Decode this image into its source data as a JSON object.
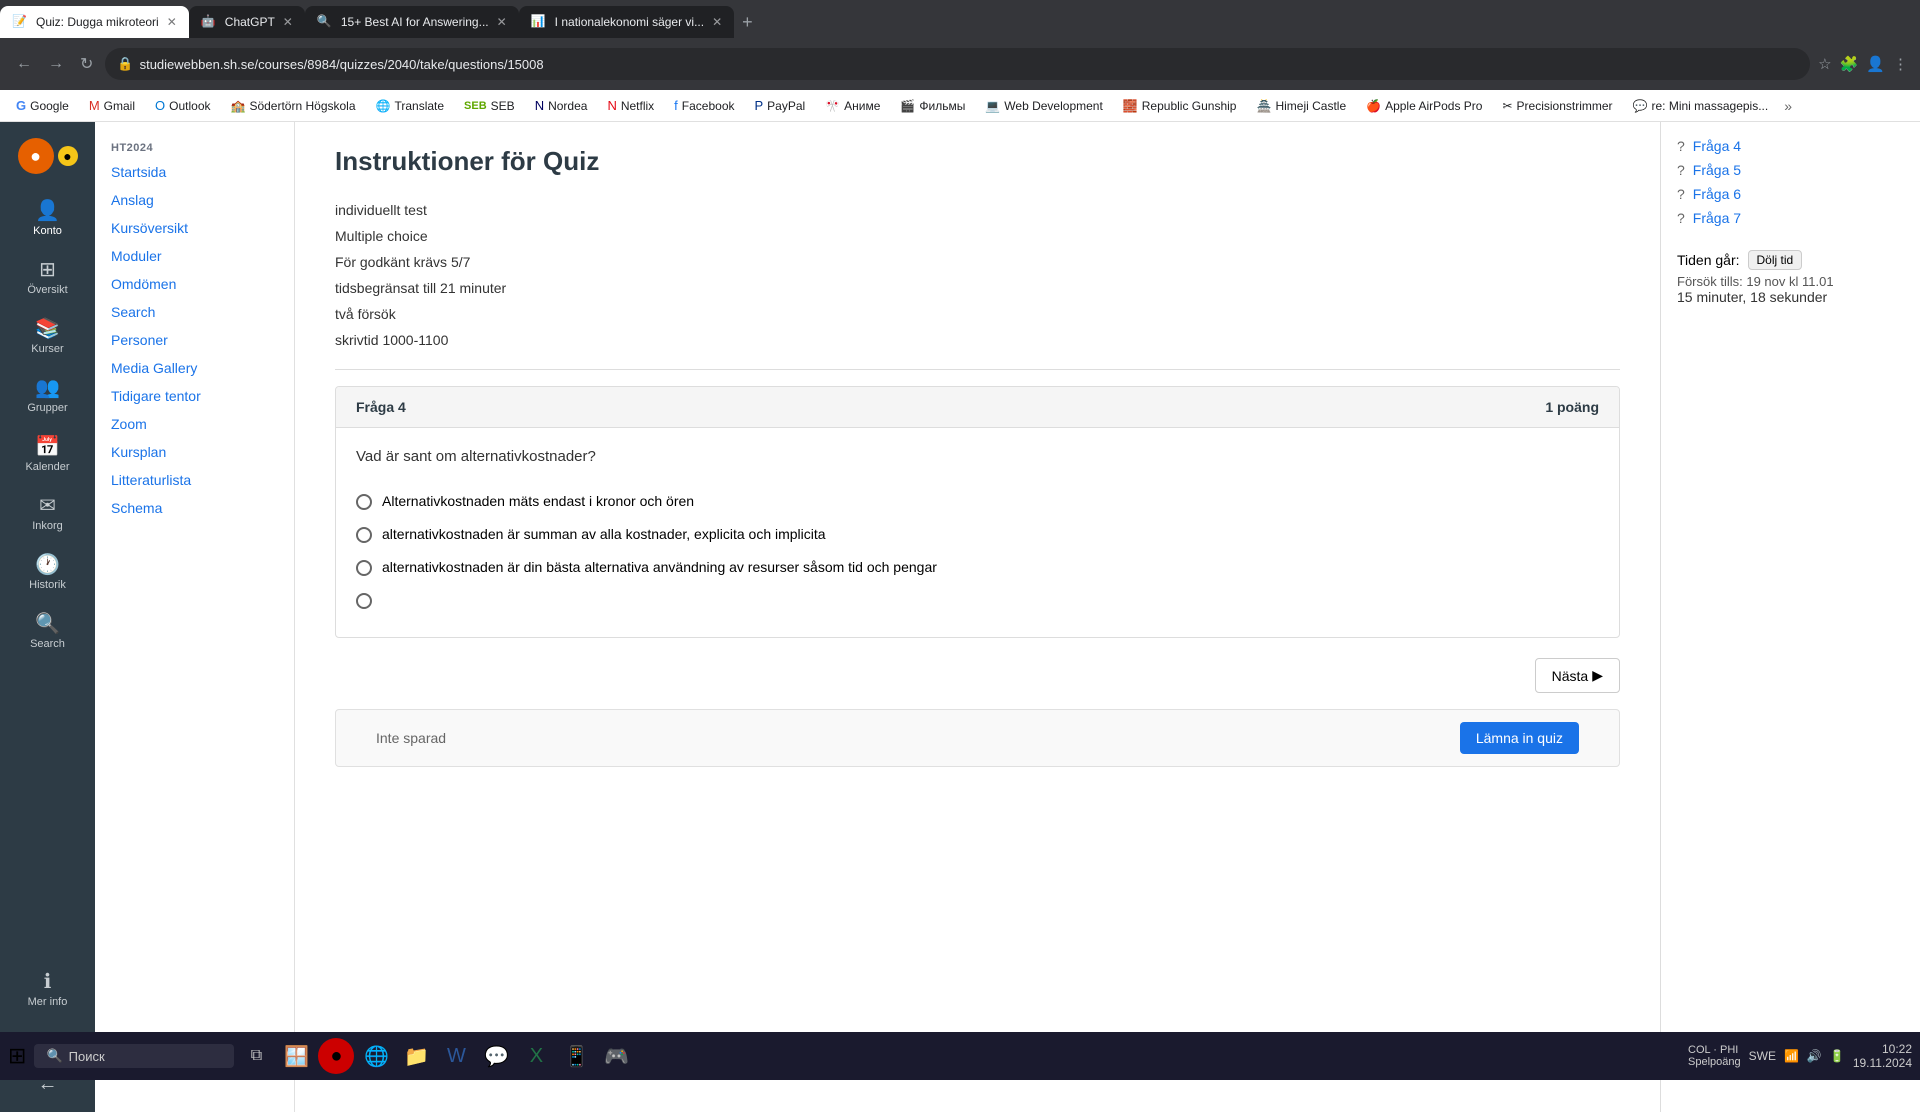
{
  "browser": {
    "tabs": [
      {
        "id": "tab1",
        "title": "Quiz: Dugga mikroteori",
        "active": true,
        "favicon": "📝"
      },
      {
        "id": "tab2",
        "title": "ChatGPT",
        "active": false,
        "favicon": "🤖"
      },
      {
        "id": "tab3",
        "title": "15+ Best AI for Answering...",
        "active": false,
        "favicon": "🔍"
      },
      {
        "id": "tab4",
        "title": "I nationalekonomi säger vi...",
        "active": false,
        "favicon": "📊"
      }
    ],
    "url": "studiewebben.sh.se/courses/8984/quizzes/2040/take/questions/15008",
    "bookmarks": [
      {
        "label": "Google",
        "icon": "G"
      },
      {
        "label": "Gmail",
        "icon": "M"
      },
      {
        "label": "Outlook",
        "icon": "O"
      },
      {
        "label": "Södertörn Högskola",
        "icon": "S"
      },
      {
        "label": "Translate",
        "icon": "T"
      },
      {
        "label": "SEB",
        "icon": "SEB"
      },
      {
        "label": "Nordea",
        "icon": "N"
      },
      {
        "label": "Netflix",
        "icon": "N"
      },
      {
        "label": "Facebook",
        "icon": "f"
      },
      {
        "label": "PayPal",
        "icon": "P"
      },
      {
        "label": "Аниме",
        "icon": "A"
      },
      {
        "label": "Фильмы",
        "icon": "F"
      },
      {
        "label": "Web Development",
        "icon": "W"
      },
      {
        "label": "Republic Gunship",
        "icon": "R"
      },
      {
        "label": "Himeji Castle",
        "icon": "H"
      },
      {
        "label": "Apple AirPods Pro",
        "icon": "A"
      },
      {
        "label": "Precisionstrimmer",
        "icon": "P"
      },
      {
        "label": "re: Mini massagepis...",
        "icon": "m"
      }
    ]
  },
  "lms_sidebar": {
    "items": [
      {
        "id": "account",
        "label": "Konto",
        "icon": "👤"
      },
      {
        "id": "overview",
        "label": "Översikt",
        "icon": "⊞"
      },
      {
        "id": "courses",
        "label": "Kurser",
        "icon": "📚"
      },
      {
        "id": "groups",
        "label": "Grupper",
        "icon": "👥"
      },
      {
        "id": "calendar",
        "label": "Kalender",
        "icon": "📅"
      },
      {
        "id": "inbox",
        "label": "Inkorg",
        "icon": "✉"
      },
      {
        "id": "history",
        "label": "Historik",
        "icon": "🕐"
      },
      {
        "id": "search",
        "label": "Search",
        "icon": "🔍"
      },
      {
        "id": "more",
        "label": "Mer info",
        "icon": "ℹ"
      }
    ]
  },
  "nav_sidebar": {
    "section_label": "HT2024",
    "items": [
      {
        "id": "startsida",
        "label": "Startsida"
      },
      {
        "id": "anslag",
        "label": "Anslag"
      },
      {
        "id": "kursöversikt",
        "label": "Kursöversikt"
      },
      {
        "id": "moduler",
        "label": "Moduler"
      },
      {
        "id": "omdömen",
        "label": "Omdömen"
      },
      {
        "id": "search",
        "label": "Search"
      },
      {
        "id": "personer",
        "label": "Personer"
      },
      {
        "id": "media_gallery",
        "label": "Media Gallery"
      },
      {
        "id": "tidigare_tentor",
        "label": "Tidigare tentor"
      },
      {
        "id": "zoom",
        "label": "Zoom"
      },
      {
        "id": "kursplan",
        "label": "Kursplan"
      },
      {
        "id": "litteraturlista",
        "label": "Litteraturlista"
      },
      {
        "id": "schema",
        "label": "Schema"
      }
    ]
  },
  "page": {
    "title": "Instruktioner för Quiz",
    "info_rows": [
      {
        "id": "type",
        "text": "individuellt test"
      },
      {
        "id": "format",
        "text": "Multiple choice"
      },
      {
        "id": "pass",
        "text": "För godkänt krävs 5/7"
      },
      {
        "id": "time_limit",
        "text": "tidsbegränsat till 21 minuter"
      },
      {
        "id": "attempts",
        "text": "två försök"
      },
      {
        "id": "write_time",
        "text": "skrivtid 1000-1100"
      }
    ]
  },
  "question": {
    "title": "Fråga 4",
    "points": "1 poäng",
    "text": "Vad är sant om alternativkostnader?",
    "options": [
      {
        "id": "a",
        "text": "Alternativkostnaden mäts endast i kronor och ören"
      },
      {
        "id": "b",
        "text": "alternativkostnaden är summan av alla kostnader, explicita och implicita"
      },
      {
        "id": "c",
        "text": "alternativkostnaden är din bästa alternativa användning av resurser såsom tid och pengar"
      },
      {
        "id": "d",
        "text": ""
      }
    ]
  },
  "right_sidebar": {
    "question_nav": [
      {
        "id": "fraga4",
        "label": "Fråga 4"
      },
      {
        "id": "fraga5",
        "label": "Fråga 5"
      },
      {
        "id": "fraga6",
        "label": "Fråga 6"
      },
      {
        "id": "fraga7",
        "label": "Fråga 7"
      }
    ],
    "timer": {
      "label": "Tiden går:",
      "hide_btn": "Dölj tid",
      "attempt_info": "Försök tills: 19 nov kl 11.01",
      "countdown": "15 minuter, 18 sekunder"
    }
  },
  "actions": {
    "next_btn": "Nästa",
    "not_saved": "Inte sparad",
    "submit_btn": "Lämna in quiz"
  },
  "taskbar": {
    "search_placeholder": "Поиск",
    "clock_time": "10:22",
    "clock_date": "19.11.2024",
    "language": "SWE",
    "battery_info": "COL · PHI\nSpelpoäng"
  }
}
